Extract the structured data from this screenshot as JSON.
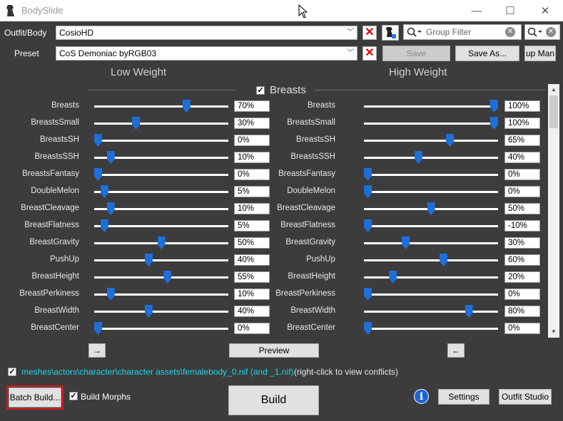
{
  "window": {
    "title": "BodySlide",
    "minimize": "—",
    "maximize": "☐",
    "close": "✕"
  },
  "outfit": {
    "label": "Outfit/Body",
    "value": "CosioHD"
  },
  "preset": {
    "label": "Preset",
    "value": "CoS Demoniac byRGB03"
  },
  "buttons": {
    "save": "Save",
    "save_as": "Save As...",
    "group_manager": "up Man",
    "preview": "Preview",
    "build": "Build",
    "batch_build": "Batch Build...",
    "settings": "Settings",
    "outfit_studio": "Outfit Studio",
    "left_arrow": "→",
    "right_arrow": "←"
  },
  "group_filter": {
    "placeholder": "Group Filter"
  },
  "headings": {
    "low": "Low Weight",
    "high": "High Weight",
    "category": "Breasts"
  },
  "sliders": [
    {
      "name": "Breasts",
      "low": 70,
      "high": 100,
      "low_text": "70%",
      "high_text": "100%"
    },
    {
      "name": "BreastsSmall",
      "low": 30,
      "high": 100,
      "low_text": "30%",
      "high_text": "100%"
    },
    {
      "name": "BreastsSH",
      "low": 0,
      "high": 65,
      "low_text": "0%",
      "high_text": "65%"
    },
    {
      "name": "BreastsSSH",
      "low": 10,
      "high": 40,
      "low_text": "10%",
      "high_text": "40%"
    },
    {
      "name": "BreastsFantasy",
      "low": 0,
      "high": 0,
      "low_text": "0%",
      "high_text": "0%"
    },
    {
      "name": "DoubleMelon",
      "low": 5,
      "high": 0,
      "low_text": "5%",
      "high_text": "0%"
    },
    {
      "name": "BreastCleavage",
      "low": 10,
      "high": 50,
      "low_text": "10%",
      "high_text": "50%"
    },
    {
      "name": "BreastFlatness",
      "low": 5,
      "high": 0,
      "low_text": "5%",
      "high_text": "-10%"
    },
    {
      "name": "BreastGravity",
      "low": 50,
      "high": 30,
      "low_text": "50%",
      "high_text": "30%"
    },
    {
      "name": "PushUp",
      "low": 40,
      "high": 60,
      "low_text": "40%",
      "high_text": "60%"
    },
    {
      "name": "BreastHeight",
      "low": 55,
      "high": 20,
      "low_text": "55%",
      "high_text": "20%"
    },
    {
      "name": "BreastPerkiness",
      "low": 10,
      "high": 0,
      "low_text": "10%",
      "high_text": "0%"
    },
    {
      "name": "BreastWidth",
      "low": 40,
      "high": 80,
      "low_text": "40%",
      "high_text": "80%"
    },
    {
      "name": "BreastCenter",
      "low": 0,
      "high": 0,
      "low_text": "0%",
      "high_text": "0%"
    }
  ],
  "output": {
    "path": "meshes\\actors\\character\\character assets\\femalebody_0.nif (and _1.nif)",
    "note": "(right-click to view conflicts)"
  },
  "build_morphs": {
    "label": "Build Morphs",
    "checked": true
  },
  "colors": {
    "accent": "#1e6fd9",
    "path_text": "#1fd5e8",
    "highlight": "#e0161c"
  }
}
